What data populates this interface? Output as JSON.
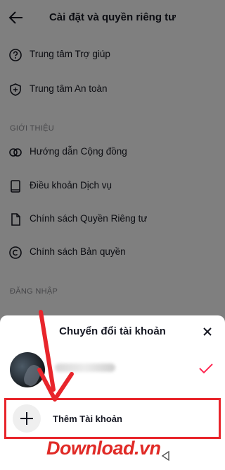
{
  "header": {
    "title": "Cài đặt và quyền riêng tư"
  },
  "support": [
    {
      "label": "Trung tâm Trợ giúp",
      "icon": "help-circle-icon"
    },
    {
      "label": "Trung tâm An toàn",
      "icon": "shield-icon"
    }
  ],
  "about": {
    "section_title": "GIỚI THIỆU",
    "items": [
      {
        "label": "Hướng dẫn Cộng đồng",
        "icon": "community-icon"
      },
      {
        "label": "Điều khoản Dịch vụ",
        "icon": "book-icon"
      },
      {
        "label": "Chính sách Quyền Riêng tư",
        "icon": "document-icon"
      },
      {
        "label": "Chính sách Bản quyền",
        "icon": "copyright-icon"
      }
    ]
  },
  "login": {
    "section_title": "ĐĂNG NHẬP"
  },
  "sheet": {
    "title": "Chuyển đổi tài khoản",
    "add_account_label": "Thêm Tài khoản"
  },
  "watermark": {
    "text": "Download",
    "suffix": ".vn"
  },
  "colors": {
    "accent": "#fe2c55",
    "highlight": "#e8252b",
    "text": "#161823",
    "muted": "#8a8b91"
  }
}
